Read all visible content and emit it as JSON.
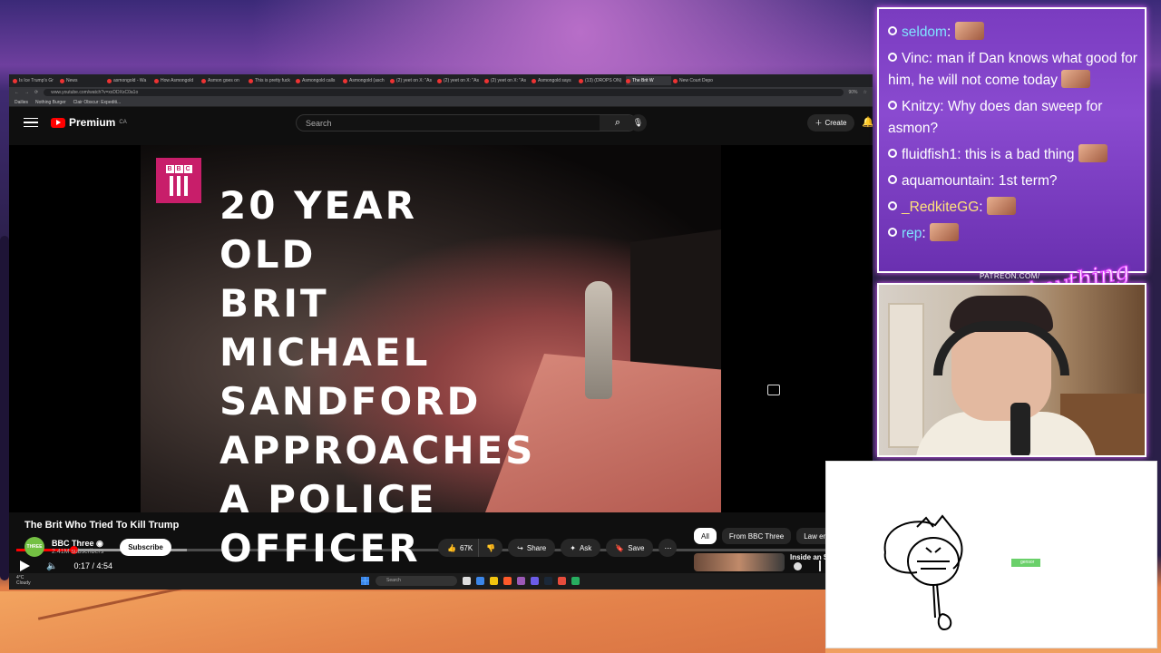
{
  "browser": {
    "tabs": [
      "Is Ice Trump's Gr",
      "News",
      "asmongold - Wa",
      "How Asmongold",
      "Asmon goes on",
      "This is pretty fuck",
      "Asmongold calls",
      "Asmongold (asch",
      "(2) yeet on X: \"As",
      "(2) yeet on X: \"As",
      "(2) yeet on X: \"As",
      "Asmongold says",
      "(13) (DROPS ON)",
      "The Brit W",
      "New Court Depo"
    ],
    "url": "www.youtube.com/watch?v=xxDDXsC0a1o",
    "zoom": "90%",
    "bookmarks": [
      "Dailies",
      "Nothing Burger",
      "Clair Obscur: Expediti..."
    ]
  },
  "youtube": {
    "logo_text": "Premium",
    "region": "CA",
    "search_placeholder": "Search",
    "create_label": "Create"
  },
  "video": {
    "channel_logo_text": "BBC",
    "headline": "20 YEAR OLD\nBRIT MICHAEL\nSANDFORD\nAPPROACHES\nA POLICE\nOFFICER",
    "time_current": "0:17",
    "time_total": "4:54",
    "time_display": "0:17 / 4:54",
    "progress_played": 0.07,
    "progress_buffered": 0.21
  },
  "info": {
    "title": "The Brit Who Tried To Kill Trump",
    "channel": "BBC Three",
    "channel_avatar_text": "THREE",
    "subscribers": "2.41M subscribers",
    "subscribe_label": "Subscribe",
    "likes": "67K",
    "share_label": "Share",
    "ask_label": "Ask",
    "save_label": "Save",
    "chips": [
      "All",
      "From BBC Three",
      "Law en"
    ],
    "rec_title": "Inside an Sweet Un"
  },
  "taskbar": {
    "weather_temp": "4°C",
    "weather_desc": "Cloudy",
    "search_label": "Search"
  },
  "chat": {
    "messages": [
      {
        "user": "seldom",
        "text": "",
        "user_color": "#7fe3ff",
        "emote": true
      },
      {
        "user": "Vinc",
        "text": "man if Dan knows what good for him, he will not come today",
        "user_color": "#ffffff",
        "emote": true
      },
      {
        "user": "Knitzy",
        "text": "Why does dan sweep for asmon?",
        "user_color": "#ffffff",
        "emote": false
      },
      {
        "user": "fluidfish1",
        "text": "this is a bad thing",
        "user_color": "#ffffff",
        "emote": true
      },
      {
        "user": "aquamountain",
        "text": "1st term?",
        "user_color": "#ffffff",
        "emote": false
      },
      {
        "user": "_RedkiteGG",
        "text": "",
        "user_color": "#ffe27a",
        "emote": true
      },
      {
        "user": "rep",
        "text": "",
        "user_color": "#7fe3ff",
        "emote": true
      }
    ]
  },
  "overlay": {
    "patreon": "PATREON.COM/",
    "signature": "Anything Else?",
    "drawing_tag": "gensor"
  }
}
